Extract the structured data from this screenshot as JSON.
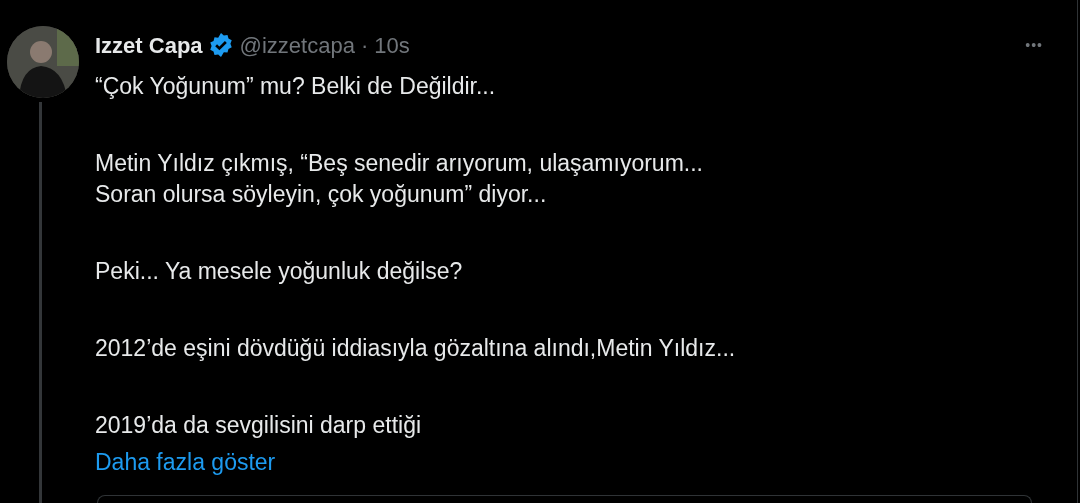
{
  "tweet": {
    "author_name": "Izzet Capa",
    "verified": true,
    "handle": "@izzetcapa",
    "separator": "·",
    "time": "10s",
    "more_menu": "•••",
    "paragraphs": [
      "“Çok Yoğunum” mu? Belki de Değildir...",
      "Metin Yıldız çıkmış, “Beş senedir arıyorum, ulaşamıyorum...\nSoran olursa söyleyin, çok yoğunum” diyor...",
      "Peki... Ya mesele yoğunluk değilse?",
      "2012’de eşini dövdüğü iddiasıyla gözaltına alındı,Metin Yıldız...",
      "2019’da da sevgilisini darp ettiği"
    ],
    "show_more": "Daha fazla göster"
  }
}
